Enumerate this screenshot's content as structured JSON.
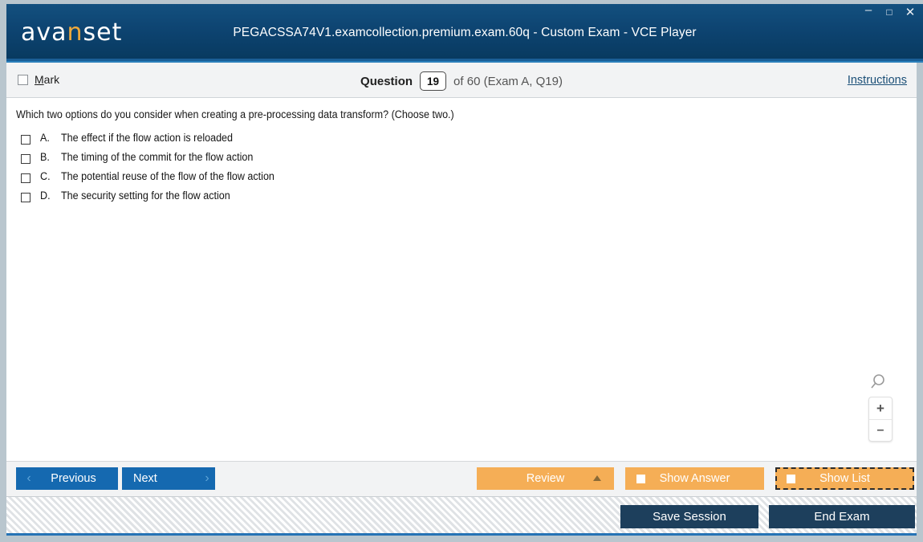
{
  "window": {
    "app_title": "PEGACSSA74V1.examcollection.premium.exam.60q - Custom Exam - VCE Player",
    "logo_part1": "ava",
    "logo_accent": "n",
    "logo_part2": "set",
    "controls": {
      "minimize": "–",
      "maximize": "□",
      "close": "✕"
    },
    "colors": {
      "title_bar": "#0d4370",
      "accent_orange": "#f5ae56",
      "primary_blue": "#1569b0",
      "dark_button": "#1d3f5c",
      "link_blue": "#1b4f77"
    }
  },
  "question_bar": {
    "mark_label_prefix": "M",
    "mark_label_rest": "ark",
    "mark_checked": false,
    "question_word": "Question",
    "question_number": "19",
    "of_text": "of 60 (Exam A, Q19)",
    "instructions_link": "Instructions"
  },
  "question": {
    "text": "Which two options do you consider when creating a pre-processing data transform? (Choose two.)",
    "options": [
      {
        "letter": "A.",
        "text": "The effect if the flow action is reloaded",
        "checked": false
      },
      {
        "letter": "B.",
        "text": "The timing of the commit for the flow action",
        "checked": false
      },
      {
        "letter": "C.",
        "text": "The potential reuse of the flow of the flow action",
        "checked": false
      },
      {
        "letter": "D.",
        "text": "The security setting for the flow action",
        "checked": false
      }
    ]
  },
  "zoom_control": {
    "magnifier_icon": "search-icon",
    "zoom_in": "+",
    "zoom_out": "–"
  },
  "nav_bar": {
    "previous": "Previous",
    "previous_chevron": "‹",
    "next": "Next",
    "next_chevron": "›",
    "review": "Review",
    "show_answer": "Show Answer",
    "show_list": "Show List"
  },
  "footer": {
    "save_session": "Save Session",
    "end_exam": "End Exam"
  }
}
